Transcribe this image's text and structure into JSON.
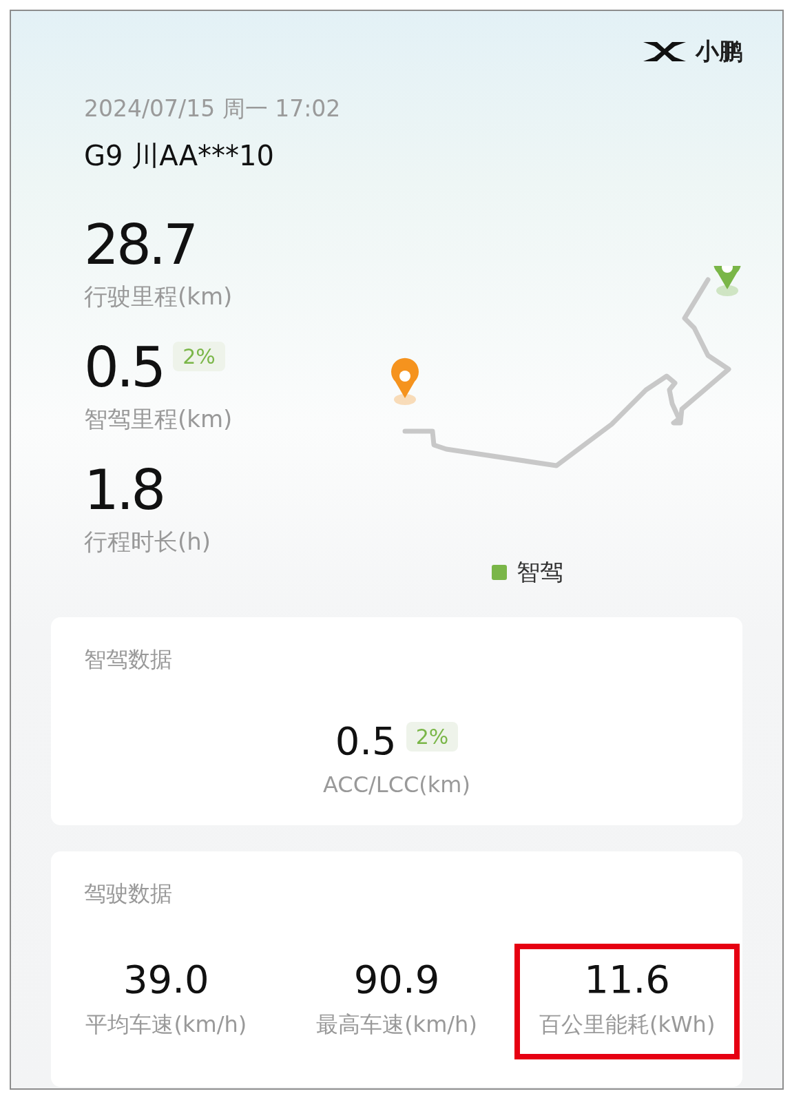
{
  "brand": {
    "name": "小鹏"
  },
  "trip": {
    "datetime": "2024/07/15 周一 17:02",
    "vehicle": "G9 川AA***10"
  },
  "stats": [
    {
      "value": "28.7",
      "label": "行驶里程(km)"
    },
    {
      "value": "0.5",
      "badge": "2%",
      "label": "智驾里程(km)"
    },
    {
      "value": "1.8",
      "label": "行程时长(h)"
    }
  ],
  "legend": [
    {
      "label": "智驾",
      "color": "#7ab648"
    }
  ],
  "assist_card": {
    "title": "智驾数据",
    "items": [
      {
        "value": "0.5",
        "badge": "2%",
        "label": "ACC/LCC(km)"
      }
    ]
  },
  "driving_card": {
    "title": "驾驶数据",
    "items": [
      {
        "value": "39.0",
        "label": "平均车速(km/h)",
        "highlighted": false
      },
      {
        "value": "90.9",
        "label": "最高车速(km/h)",
        "highlighted": false
      },
      {
        "value": "11.6",
        "label": "百公里能耗(kWh)",
        "highlighted": true
      }
    ]
  }
}
